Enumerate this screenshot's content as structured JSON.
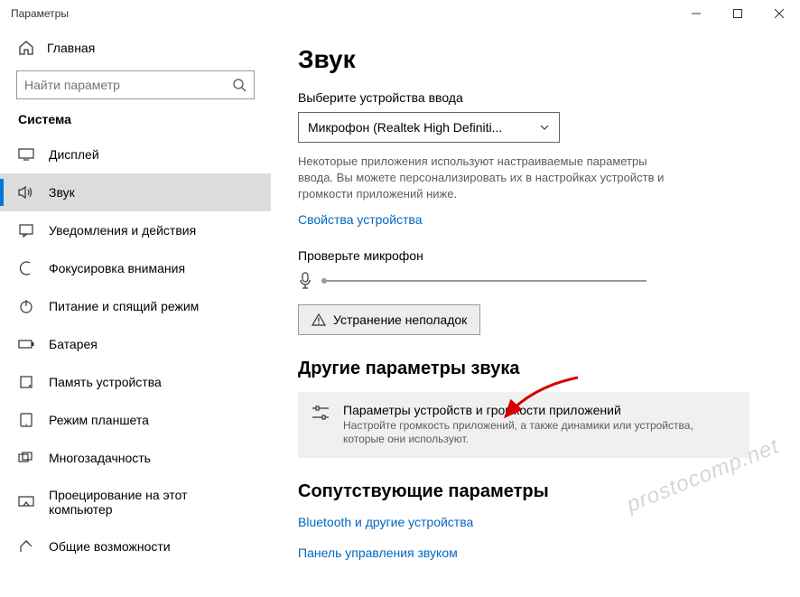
{
  "window": {
    "title": "Параметры"
  },
  "sidebar": {
    "home": "Главная",
    "search_placeholder": "Найти параметр",
    "section": "Система",
    "items": [
      {
        "label": "Дисплей"
      },
      {
        "label": "Звук"
      },
      {
        "label": "Уведомления и действия"
      },
      {
        "label": "Фокусировка внимания"
      },
      {
        "label": "Питание и спящий режим"
      },
      {
        "label": "Батарея"
      },
      {
        "label": "Память устройства"
      },
      {
        "label": "Режим планшета"
      },
      {
        "label": "Многозадачность"
      },
      {
        "label": "Проецирование на этот компьютер"
      },
      {
        "label": "Общие возможности"
      }
    ]
  },
  "main": {
    "title": "Звук",
    "input_label": "Выберите устройства ввода",
    "input_device": "Микрофон (Realtek High Definiti...",
    "input_desc": "Некоторые приложения используют настраиваемые параметры ввода. Вы можете персонализировать их в настройках устройств и громкости приложений ниже.",
    "device_props": "Свойства устройства",
    "test_mic": "Проверьте микрофон",
    "troubleshoot": "Устранение неполадок",
    "other_title": "Другие параметры звука",
    "option_title": "Параметры устройств и громкости приложений",
    "option_desc": "Настройте громкость приложений, а также динамики или устройства, которые они используют.",
    "related_title": "Сопутствующие параметры",
    "link_bt": "Bluetooth и другие устройства",
    "link_cp": "Панель управления звуком"
  },
  "watermark": "prostocomp.net"
}
